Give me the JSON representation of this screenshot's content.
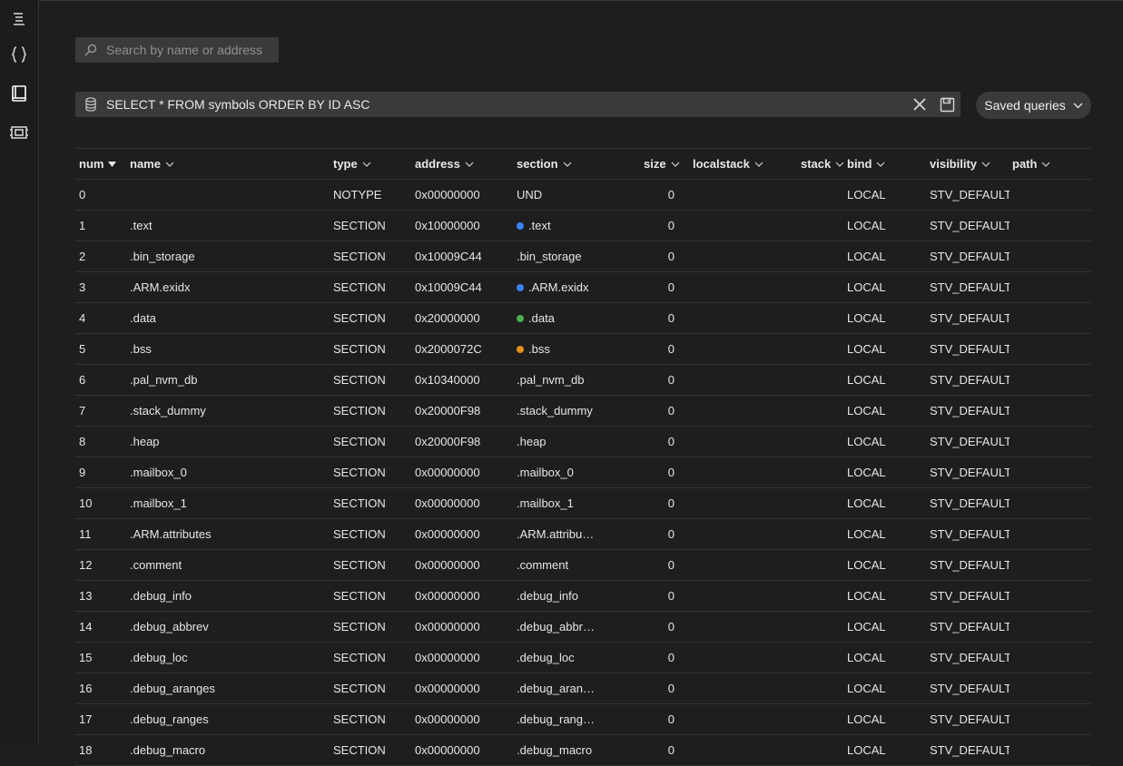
{
  "search": {
    "placeholder": "Search by name or address"
  },
  "query": {
    "text": "SELECT * FROM symbols ORDER BY ID ASC"
  },
  "saved_queries": {
    "label": "Saved queries"
  },
  "columns": [
    {
      "key": "num",
      "label": "num",
      "sorted": "desc"
    },
    {
      "key": "name",
      "label": "name"
    },
    {
      "key": "type",
      "label": "type"
    },
    {
      "key": "address",
      "label": "address"
    },
    {
      "key": "section",
      "label": "section"
    },
    {
      "key": "size",
      "label": "size"
    },
    {
      "key": "localstack",
      "label": "localstack"
    },
    {
      "key": "stack",
      "label": "stack"
    },
    {
      "key": "bind",
      "label": "bind"
    },
    {
      "key": "visibility",
      "label": "visibility"
    },
    {
      "key": "path",
      "label": "path"
    }
  ],
  "colors": {
    "blue": "#3b82f6",
    "green": "#4caf50",
    "orange": "#e3901b"
  },
  "rows": [
    {
      "num": "0",
      "name": "",
      "type": "NOTYPE",
      "address": "0x00000000",
      "section": "UND",
      "dot": "",
      "size": "0",
      "bind": "LOCAL",
      "visibility": "STV_DEFAULT"
    },
    {
      "num": "1",
      "name": ".text",
      "type": "SECTION",
      "address": "0x10000000",
      "section": ".text",
      "dot": "blue",
      "size": "0",
      "bind": "LOCAL",
      "visibility": "STV_DEFAULT"
    },
    {
      "num": "2",
      "name": ".bin_storage",
      "type": "SECTION",
      "address": "0x10009C44",
      "section": ".bin_storage",
      "dot": "",
      "size": "0",
      "bind": "LOCAL",
      "visibility": "STV_DEFAULT"
    },
    {
      "num": "3",
      "name": ".ARM.exidx",
      "type": "SECTION",
      "address": "0x10009C44",
      "section": ".ARM.exidx",
      "dot": "blue",
      "size": "0",
      "bind": "LOCAL",
      "visibility": "STV_DEFAULT"
    },
    {
      "num": "4",
      "name": ".data",
      "type": "SECTION",
      "address": "0x20000000",
      "section": ".data",
      "dot": "green",
      "size": "0",
      "bind": "LOCAL",
      "visibility": "STV_DEFAULT"
    },
    {
      "num": "5",
      "name": ".bss",
      "type": "SECTION",
      "address": "0x2000072C",
      "section": ".bss",
      "dot": "orange",
      "size": "0",
      "bind": "LOCAL",
      "visibility": "STV_DEFAULT"
    },
    {
      "num": "6",
      "name": ".pal_nvm_db",
      "type": "SECTION",
      "address": "0x10340000",
      "section": ".pal_nvm_db",
      "dot": "",
      "size": "0",
      "bind": "LOCAL",
      "visibility": "STV_DEFAULT"
    },
    {
      "num": "7",
      "name": ".stack_dummy",
      "type": "SECTION",
      "address": "0x20000F98",
      "section": ".stack_dummy",
      "dot": "",
      "size": "0",
      "bind": "LOCAL",
      "visibility": "STV_DEFAULT"
    },
    {
      "num": "8",
      "name": ".heap",
      "type": "SECTION",
      "address": "0x20000F98",
      "section": ".heap",
      "dot": "",
      "size": "0",
      "bind": "LOCAL",
      "visibility": "STV_DEFAULT"
    },
    {
      "num": "9",
      "name": ".mailbox_0",
      "type": "SECTION",
      "address": "0x00000000",
      "section": ".mailbox_0",
      "dot": "",
      "size": "0",
      "bind": "LOCAL",
      "visibility": "STV_DEFAULT"
    },
    {
      "num": "10",
      "name": ".mailbox_1",
      "type": "SECTION",
      "address": "0x00000000",
      "section": ".mailbox_1",
      "dot": "",
      "size": "0",
      "bind": "LOCAL",
      "visibility": "STV_DEFAULT"
    },
    {
      "num": "11",
      "name": ".ARM.attributes",
      "type": "SECTION",
      "address": "0x00000000",
      "section": ".ARM.attribu…",
      "dot": "",
      "size": "0",
      "bind": "LOCAL",
      "visibility": "STV_DEFAULT"
    },
    {
      "num": "12",
      "name": ".comment",
      "type": "SECTION",
      "address": "0x00000000",
      "section": ".comment",
      "dot": "",
      "size": "0",
      "bind": "LOCAL",
      "visibility": "STV_DEFAULT"
    },
    {
      "num": "13",
      "name": ".debug_info",
      "type": "SECTION",
      "address": "0x00000000",
      "section": ".debug_info",
      "dot": "",
      "size": "0",
      "bind": "LOCAL",
      "visibility": "STV_DEFAULT"
    },
    {
      "num": "14",
      "name": ".debug_abbrev",
      "type": "SECTION",
      "address": "0x00000000",
      "section": ".debug_abbr…",
      "dot": "",
      "size": "0",
      "bind": "LOCAL",
      "visibility": "STV_DEFAULT"
    },
    {
      "num": "15",
      "name": ".debug_loc",
      "type": "SECTION",
      "address": "0x00000000",
      "section": ".debug_loc",
      "dot": "",
      "size": "0",
      "bind": "LOCAL",
      "visibility": "STV_DEFAULT"
    },
    {
      "num": "16",
      "name": ".debug_aranges",
      "type": "SECTION",
      "address": "0x00000000",
      "section": ".debug_aran…",
      "dot": "",
      "size": "0",
      "bind": "LOCAL",
      "visibility": "STV_DEFAULT"
    },
    {
      "num": "17",
      "name": ".debug_ranges",
      "type": "SECTION",
      "address": "0x00000000",
      "section": ".debug_rang…",
      "dot": "",
      "size": "0",
      "bind": "LOCAL",
      "visibility": "STV_DEFAULT"
    },
    {
      "num": "18",
      "name": ".debug_macro",
      "type": "SECTION",
      "address": "0x00000000",
      "section": ".debug_macro",
      "dot": "",
      "size": "0",
      "bind": "LOCAL",
      "visibility": "STV_DEFAULT"
    }
  ]
}
